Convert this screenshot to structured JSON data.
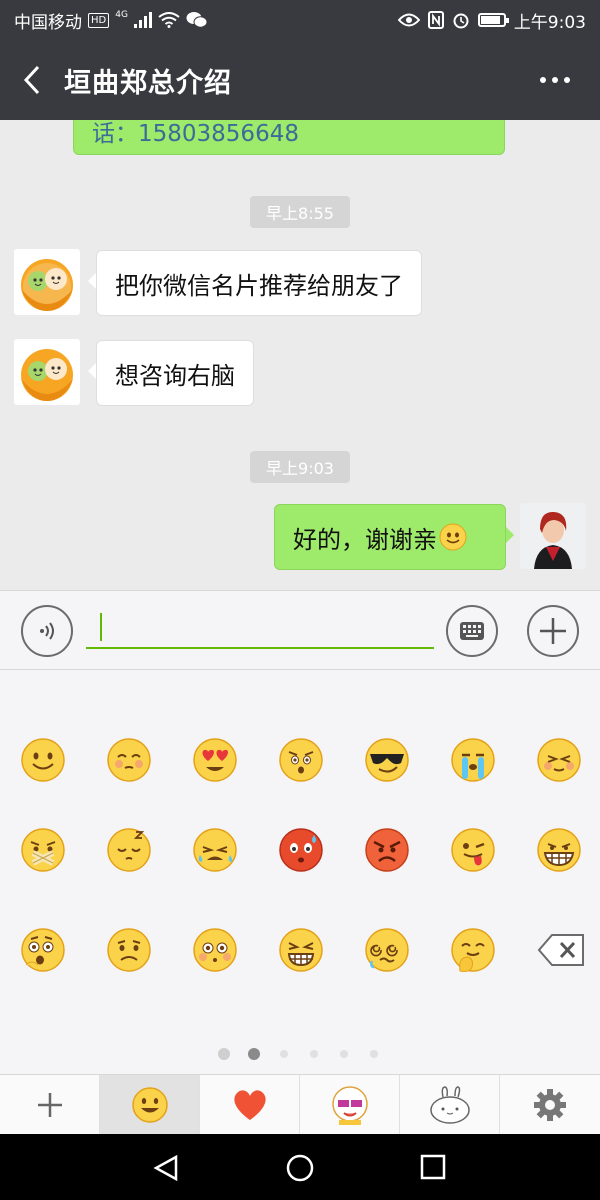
{
  "status_bar": {
    "carrier": "中国移动",
    "hd": "HD",
    "network": "4G",
    "battery_level": 0.85,
    "time": "上午9:03"
  },
  "header": {
    "title": "垣曲郑总介绍"
  },
  "messages": {
    "partial_text": "话：15803856648",
    "time_1": "早上8:55",
    "msg_1": "把你微信名片推荐给朋友了",
    "msg_2": "想咨询右脑",
    "time_2": "早上9:03",
    "msg_3": "好的，谢谢亲"
  },
  "emoji_panel": {
    "rows": [
      [
        "smile",
        "blush",
        "love",
        "surprise",
        "cool",
        "cry",
        "mischief"
      ],
      [
        "shush",
        "sleepy",
        "tears",
        "angry-red",
        "furious",
        "tongue",
        "grin"
      ],
      [
        "shock",
        "sad",
        "blush-eyes",
        "scream",
        "dizzy",
        "giggle",
        "backspace"
      ]
    ],
    "page_count": 6,
    "current_page": 2
  },
  "tab_bar": {
    "tabs": [
      "add",
      "emoji",
      "favorites",
      "sticker-face",
      "sticker-bunny",
      "settings"
    ],
    "active": "emoji"
  },
  "colors": {
    "title_bar": "#393a3f",
    "bubble_green": "#9eea6a",
    "accent": "#62b900"
  }
}
